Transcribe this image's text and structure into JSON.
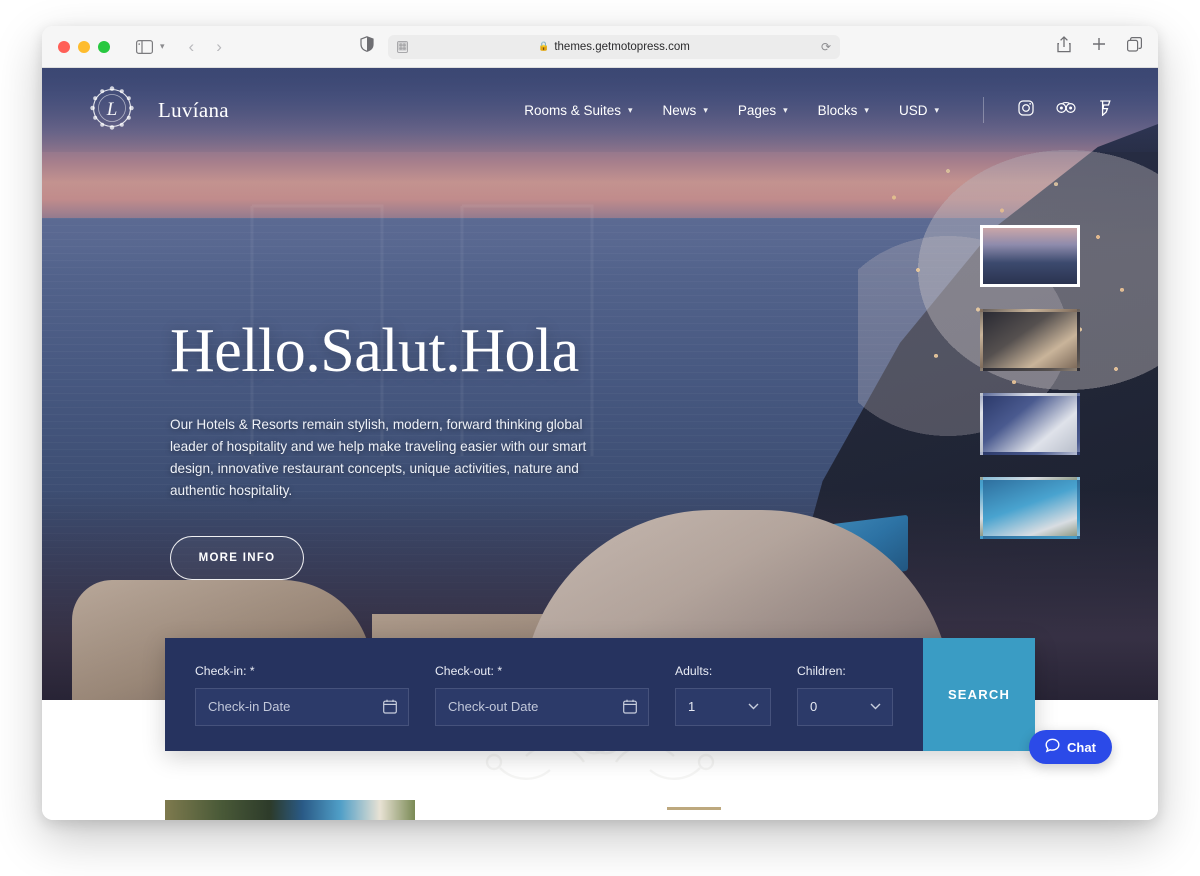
{
  "browser": {
    "url": "themes.getmotopress.com",
    "lock_icon": "lock-icon",
    "reader_icon": "reader-view-icon",
    "reload_icon": "reload-icon",
    "shield_icon": "privacy-shield-icon",
    "sidebar_icon": "sidebar-toggle-icon",
    "back_icon": "back-arrow-icon",
    "forward_icon": "forward-arrow-icon",
    "share_icon": "share-icon",
    "new_tab_icon": "plus-icon",
    "tabs_icon": "tab-overview-icon"
  },
  "site": {
    "brand": "Luvíana",
    "logo_icon": "luviana-wreath-logo",
    "nav": [
      {
        "label": "Rooms & Suites",
        "has_dropdown": true
      },
      {
        "label": "News",
        "has_dropdown": true
      },
      {
        "label": "Pages",
        "has_dropdown": true
      },
      {
        "label": "Blocks",
        "has_dropdown": true
      },
      {
        "label": "USD",
        "has_dropdown": true
      }
    ],
    "socials": [
      {
        "name": "instagram-icon"
      },
      {
        "name": "tripadvisor-icon"
      },
      {
        "name": "foursquare-icon"
      }
    ]
  },
  "hero": {
    "title": "Hello.Salut.Hola",
    "paragraph": "Our Hotels & Resorts remain stylish, modern, forward thinking global leader of hospitality and we help make traveling easier with our smart design, innovative restaurant concepts, unique activities, nature and authentic hospitality.",
    "cta": "MORE INFO",
    "slides_total": 4,
    "active_slide": 1,
    "thumbnails": [
      {
        "name": "thumb-sunset-caldera",
        "active": true
      },
      {
        "name": "thumb-restaurant-table",
        "active": false
      },
      {
        "name": "thumb-hotel-room",
        "active": false
      },
      {
        "name": "thumb-sea-village",
        "active": false
      }
    ]
  },
  "booking": {
    "checkin_label": "Check-in:",
    "checkin_required": "*",
    "checkin_placeholder": "Check-in Date",
    "checkin_value": "",
    "checkout_label": "Check-out:",
    "checkout_required": "*",
    "checkout_placeholder": "Check-out Date",
    "checkout_value": "",
    "adults_label": "Adults:",
    "adults_value": "1",
    "children_label": "Children:",
    "children_value": "0",
    "search_label": "SEARCH",
    "calendar_icon": "calendar-icon",
    "chevron_icon": "chevron-down-icon",
    "bar_color": "#26335f",
    "search_color": "#3a9cc4"
  },
  "chat": {
    "label": "Chat",
    "icon": "chat-bubble-icon",
    "color": "#2b4ae8"
  }
}
